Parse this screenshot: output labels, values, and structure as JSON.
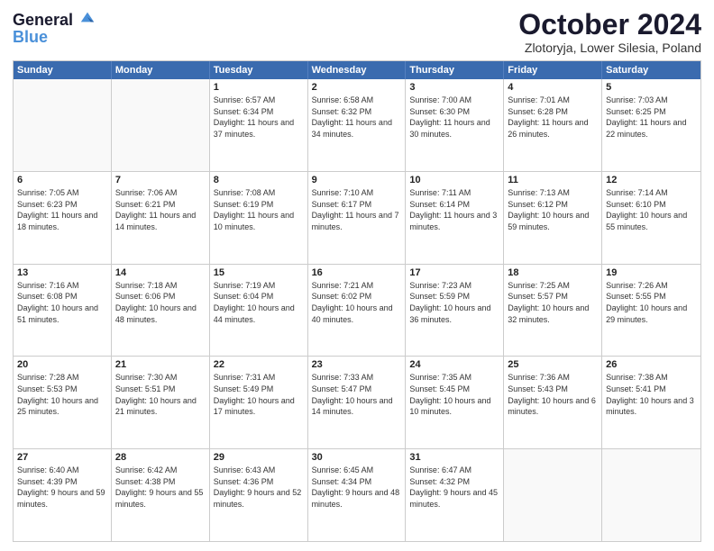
{
  "header": {
    "logo_line1": "General",
    "logo_line2": "Blue",
    "title": "October 2024",
    "subtitle": "Zlotoryja, Lower Silesia, Poland"
  },
  "weekdays": [
    "Sunday",
    "Monday",
    "Tuesday",
    "Wednesday",
    "Thursday",
    "Friday",
    "Saturday"
  ],
  "weeks": [
    [
      {
        "day": "",
        "sunrise": "",
        "sunset": "",
        "daylight": "",
        "empty": true
      },
      {
        "day": "",
        "sunrise": "",
        "sunset": "",
        "daylight": "",
        "empty": true
      },
      {
        "day": "1",
        "sunrise": "Sunrise: 6:57 AM",
        "sunset": "Sunset: 6:34 PM",
        "daylight": "Daylight: 11 hours and 37 minutes."
      },
      {
        "day": "2",
        "sunrise": "Sunrise: 6:58 AM",
        "sunset": "Sunset: 6:32 PM",
        "daylight": "Daylight: 11 hours and 34 minutes."
      },
      {
        "day": "3",
        "sunrise": "Sunrise: 7:00 AM",
        "sunset": "Sunset: 6:30 PM",
        "daylight": "Daylight: 11 hours and 30 minutes."
      },
      {
        "day": "4",
        "sunrise": "Sunrise: 7:01 AM",
        "sunset": "Sunset: 6:28 PM",
        "daylight": "Daylight: 11 hours and 26 minutes."
      },
      {
        "day": "5",
        "sunrise": "Sunrise: 7:03 AM",
        "sunset": "Sunset: 6:25 PM",
        "daylight": "Daylight: 11 hours and 22 minutes."
      }
    ],
    [
      {
        "day": "6",
        "sunrise": "Sunrise: 7:05 AM",
        "sunset": "Sunset: 6:23 PM",
        "daylight": "Daylight: 11 hours and 18 minutes."
      },
      {
        "day": "7",
        "sunrise": "Sunrise: 7:06 AM",
        "sunset": "Sunset: 6:21 PM",
        "daylight": "Daylight: 11 hours and 14 minutes."
      },
      {
        "day": "8",
        "sunrise": "Sunrise: 7:08 AM",
        "sunset": "Sunset: 6:19 PM",
        "daylight": "Daylight: 11 hours and 10 minutes."
      },
      {
        "day": "9",
        "sunrise": "Sunrise: 7:10 AM",
        "sunset": "Sunset: 6:17 PM",
        "daylight": "Daylight: 11 hours and 7 minutes."
      },
      {
        "day": "10",
        "sunrise": "Sunrise: 7:11 AM",
        "sunset": "Sunset: 6:14 PM",
        "daylight": "Daylight: 11 hours and 3 minutes."
      },
      {
        "day": "11",
        "sunrise": "Sunrise: 7:13 AM",
        "sunset": "Sunset: 6:12 PM",
        "daylight": "Daylight: 10 hours and 59 minutes."
      },
      {
        "day": "12",
        "sunrise": "Sunrise: 7:14 AM",
        "sunset": "Sunset: 6:10 PM",
        "daylight": "Daylight: 10 hours and 55 minutes."
      }
    ],
    [
      {
        "day": "13",
        "sunrise": "Sunrise: 7:16 AM",
        "sunset": "Sunset: 6:08 PM",
        "daylight": "Daylight: 10 hours and 51 minutes."
      },
      {
        "day": "14",
        "sunrise": "Sunrise: 7:18 AM",
        "sunset": "Sunset: 6:06 PM",
        "daylight": "Daylight: 10 hours and 48 minutes."
      },
      {
        "day": "15",
        "sunrise": "Sunrise: 7:19 AM",
        "sunset": "Sunset: 6:04 PM",
        "daylight": "Daylight: 10 hours and 44 minutes."
      },
      {
        "day": "16",
        "sunrise": "Sunrise: 7:21 AM",
        "sunset": "Sunset: 6:02 PM",
        "daylight": "Daylight: 10 hours and 40 minutes."
      },
      {
        "day": "17",
        "sunrise": "Sunrise: 7:23 AM",
        "sunset": "Sunset: 5:59 PM",
        "daylight": "Daylight: 10 hours and 36 minutes."
      },
      {
        "day": "18",
        "sunrise": "Sunrise: 7:25 AM",
        "sunset": "Sunset: 5:57 PM",
        "daylight": "Daylight: 10 hours and 32 minutes."
      },
      {
        "day": "19",
        "sunrise": "Sunrise: 7:26 AM",
        "sunset": "Sunset: 5:55 PM",
        "daylight": "Daylight: 10 hours and 29 minutes."
      }
    ],
    [
      {
        "day": "20",
        "sunrise": "Sunrise: 7:28 AM",
        "sunset": "Sunset: 5:53 PM",
        "daylight": "Daylight: 10 hours and 25 minutes."
      },
      {
        "day": "21",
        "sunrise": "Sunrise: 7:30 AM",
        "sunset": "Sunset: 5:51 PM",
        "daylight": "Daylight: 10 hours and 21 minutes."
      },
      {
        "day": "22",
        "sunrise": "Sunrise: 7:31 AM",
        "sunset": "Sunset: 5:49 PM",
        "daylight": "Daylight: 10 hours and 17 minutes."
      },
      {
        "day": "23",
        "sunrise": "Sunrise: 7:33 AM",
        "sunset": "Sunset: 5:47 PM",
        "daylight": "Daylight: 10 hours and 14 minutes."
      },
      {
        "day": "24",
        "sunrise": "Sunrise: 7:35 AM",
        "sunset": "Sunset: 5:45 PM",
        "daylight": "Daylight: 10 hours and 10 minutes."
      },
      {
        "day": "25",
        "sunrise": "Sunrise: 7:36 AM",
        "sunset": "Sunset: 5:43 PM",
        "daylight": "Daylight: 10 hours and 6 minutes."
      },
      {
        "day": "26",
        "sunrise": "Sunrise: 7:38 AM",
        "sunset": "Sunset: 5:41 PM",
        "daylight": "Daylight: 10 hours and 3 minutes."
      }
    ],
    [
      {
        "day": "27",
        "sunrise": "Sunrise: 6:40 AM",
        "sunset": "Sunset: 4:39 PM",
        "daylight": "Daylight: 9 hours and 59 minutes."
      },
      {
        "day": "28",
        "sunrise": "Sunrise: 6:42 AM",
        "sunset": "Sunset: 4:38 PM",
        "daylight": "Daylight: 9 hours and 55 minutes."
      },
      {
        "day": "29",
        "sunrise": "Sunrise: 6:43 AM",
        "sunset": "Sunset: 4:36 PM",
        "daylight": "Daylight: 9 hours and 52 minutes."
      },
      {
        "day": "30",
        "sunrise": "Sunrise: 6:45 AM",
        "sunset": "Sunset: 4:34 PM",
        "daylight": "Daylight: 9 hours and 48 minutes."
      },
      {
        "day": "31",
        "sunrise": "Sunrise: 6:47 AM",
        "sunset": "Sunset: 4:32 PM",
        "daylight": "Daylight: 9 hours and 45 minutes."
      },
      {
        "day": "",
        "sunrise": "",
        "sunset": "",
        "daylight": "",
        "empty": true
      },
      {
        "day": "",
        "sunrise": "",
        "sunset": "",
        "daylight": "",
        "empty": true
      }
    ]
  ]
}
